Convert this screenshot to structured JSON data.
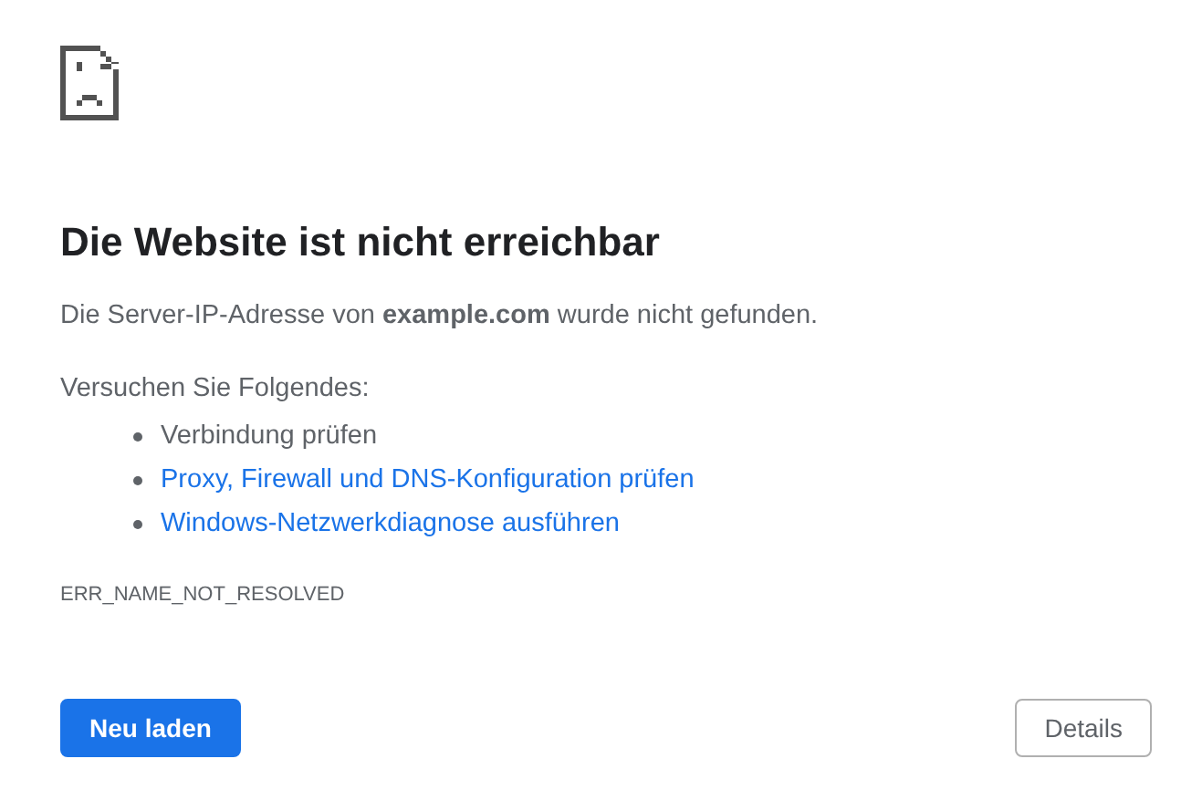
{
  "heading": "Die Website ist nicht erreichbar",
  "message": "Die Server-IP-Adresse von **example.com** wurde nicht gefunden.",
  "suggestions_intro": "Versuchen Sie Folgendes:",
  "suggestions": [
    {
      "kind": "text",
      "label": "Verbindung prüfen"
    },
    {
      "kind": "link",
      "label": "Proxy, Firewall und DNS-Konfiguration prüfen"
    },
    {
      "kind": "link",
      "label": "Windows-Netzwerkdiagnose ausführen"
    }
  ],
  "error_code": "ERR_NAME_NOT_RESOLVED",
  "buttons": [
    {
      "kind": "primary",
      "label": "Neu laden"
    },
    {
      "kind": "secondary",
      "label": "Details"
    }
  ]
}
